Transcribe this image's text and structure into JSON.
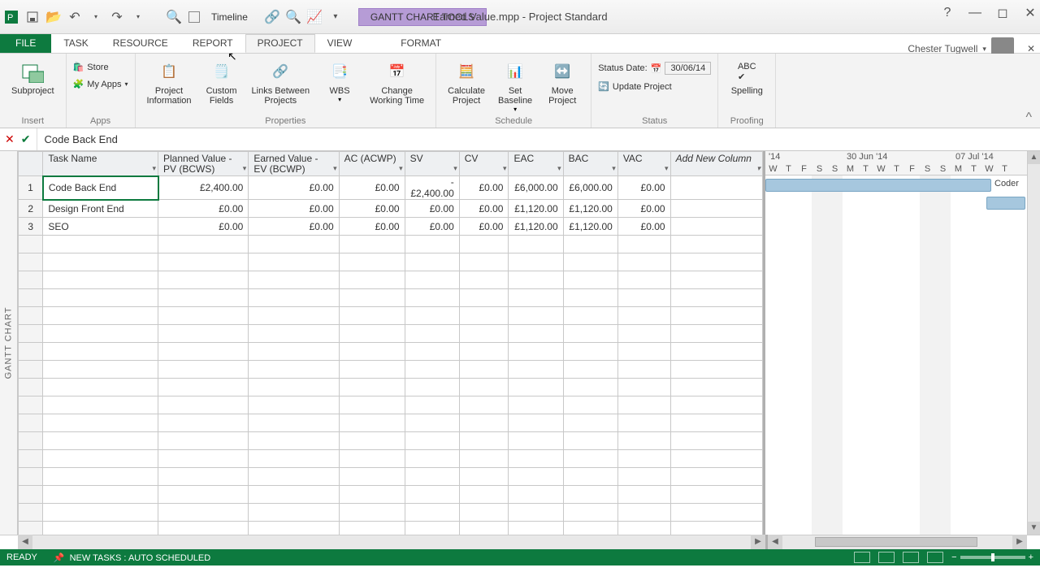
{
  "app": {
    "tool_tab": "GANTT CHART TOOLS",
    "title": "Earned Value.mpp - Project Standard"
  },
  "qat": {
    "timeline_label": "Timeline"
  },
  "tabs": {
    "file": "FILE",
    "task": "TASK",
    "resource": "RESOURCE",
    "report": "REPORT",
    "project": "PROJECT",
    "view": "VIEW",
    "format": "FORMAT"
  },
  "user": {
    "name": "Chester Tugwell"
  },
  "ribbon": {
    "insert": {
      "subproject": "Subproject",
      "group": "Insert"
    },
    "apps": {
      "store": "Store",
      "myapps": "My Apps",
      "group": "Apps"
    },
    "properties": {
      "project_info": "Project\nInformation",
      "custom_fields": "Custom\nFields",
      "links": "Links Between\nProjects",
      "wbs": "WBS",
      "cwt": "Change\nWorking Time",
      "group": "Properties"
    },
    "schedule": {
      "calc": "Calculate\nProject",
      "baseline": "Set\nBaseline",
      "move": "Move\nProject",
      "group": "Schedule"
    },
    "status": {
      "date_label": "Status Date:",
      "date_value": "30/06/14",
      "update": "Update Project",
      "group": "Status"
    },
    "proofing": {
      "spelling": "Spelling",
      "group": "Proofing"
    }
  },
  "formula_bar": {
    "value": "Code Back End"
  },
  "side_label": "GANTT CHART",
  "columns": {
    "task_name": "Task Name",
    "pv": "Planned Value - PV (BCWS)",
    "ev": "Earned Value - EV (BCWP)",
    "ac": "AC (ACWP)",
    "sv": "SV",
    "cv": "CV",
    "eac": "EAC",
    "bac": "BAC",
    "vac": "VAC",
    "add": "Add New Column"
  },
  "rows": [
    {
      "n": "1",
      "name": "Code Back End",
      "pv": "£2,400.00",
      "ev": "£0.00",
      "ac": "£0.00",
      "sv": "-£2,400.00",
      "cv": "£0.00",
      "eac": "£6,000.00",
      "bac": "£6,000.00",
      "vac": "£0.00"
    },
    {
      "n": "2",
      "name": "Design Front End",
      "pv": "£0.00",
      "ev": "£0.00",
      "ac": "£0.00",
      "sv": "£0.00",
      "cv": "£0.00",
      "eac": "£1,120.00",
      "bac": "£1,120.00",
      "vac": "£0.00"
    },
    {
      "n": "3",
      "name": "SEO",
      "pv": "£0.00",
      "ev": "£0.00",
      "ac": "£0.00",
      "sv": "£0.00",
      "cv": "£0.00",
      "eac": "£1,120.00",
      "bac": "£1,120.00",
      "vac": "£0.00"
    }
  ],
  "gantt": {
    "period1": "'14",
    "period2": "30 Jun '14",
    "period3": "07 Jul '14",
    "days1": [
      "W",
      "T",
      "F",
      "S",
      "S"
    ],
    "days2": [
      "M",
      "T",
      "W",
      "T",
      "F",
      "S",
      "S"
    ],
    "days3": [
      "M",
      "T",
      "W",
      "T"
    ],
    "bar_label": "Coder"
  },
  "statusbar": {
    "ready": "READY",
    "mode": "NEW TASKS : AUTO SCHEDULED"
  }
}
